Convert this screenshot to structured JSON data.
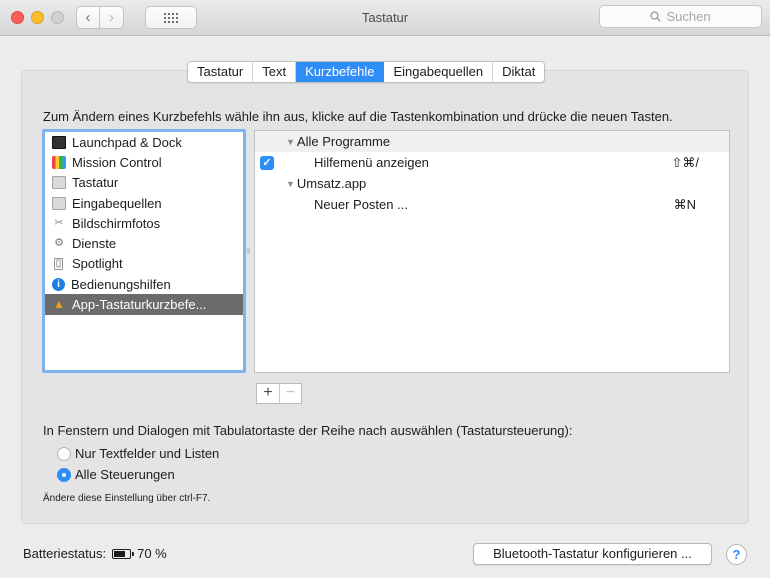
{
  "window": {
    "title": "Tastatur"
  },
  "search": {
    "placeholder": "Suchen"
  },
  "tabs": [
    {
      "label": "Tastatur",
      "active": false
    },
    {
      "label": "Text",
      "active": false
    },
    {
      "label": "Kurzbefehle",
      "active": true
    },
    {
      "label": "Eingabequellen",
      "active": false
    },
    {
      "label": "Diktat",
      "active": false
    }
  ],
  "instruction": "Zum Ändern eines Kurzbefehls wähle ihn aus, klicke auf die Tastenkombination und drücke die neuen Tasten.",
  "categories": [
    {
      "label": "Launchpad & Dock",
      "icon": "launchpad-icon"
    },
    {
      "label": "Mission Control",
      "icon": "mission-control-icon"
    },
    {
      "label": "Tastatur",
      "icon": "keyboard-icon"
    },
    {
      "label": "Eingabequellen",
      "icon": "input-sources-icon"
    },
    {
      "label": "Bildschirmfotos",
      "icon": "screenshot-icon"
    },
    {
      "label": "Dienste",
      "icon": "services-gear-icon"
    },
    {
      "label": "Spotlight",
      "icon": "spotlight-icon"
    },
    {
      "label": "Bedienungshilfen",
      "icon": "accessibility-icon"
    },
    {
      "label": "App-Tastaturkurzbefe...",
      "icon": "app-shortcuts-icon",
      "selected": true
    }
  ],
  "shortcuts": {
    "groups": [
      {
        "label": "Alle Programme",
        "items": [
          {
            "name": "Hilfemenü anzeigen",
            "key": "⇧⌘/",
            "checked": true
          }
        ]
      },
      {
        "label": "Umsatz.app",
        "items": [
          {
            "name": "Neuer Posten ...",
            "key": "⌘N",
            "checked": false
          }
        ]
      }
    ]
  },
  "buttons": {
    "add": "+",
    "remove": "−"
  },
  "tab_navigation": {
    "label": "In Fenstern und Dialogen mit Tabulatortaste der Reihe nach auswählen (Tastatursteuerung):",
    "options": [
      {
        "label": "Nur Textfelder und Listen",
        "selected": false
      },
      {
        "label": "Alle Steuerungen",
        "selected": true
      }
    ],
    "hint": "Ändere diese Einstellung über ctrl-F7."
  },
  "footer": {
    "battery_label": "Batteriestatus:",
    "battery_percent": "70 %",
    "battery_level": 0.7,
    "bluetooth_button": "Bluetooth-Tastatur konfigurieren ...",
    "help": "?"
  },
  "colors": {
    "accent": "#2f8df8",
    "selection": "#6b6b6b",
    "focus_ring": "#7fb3ec"
  }
}
